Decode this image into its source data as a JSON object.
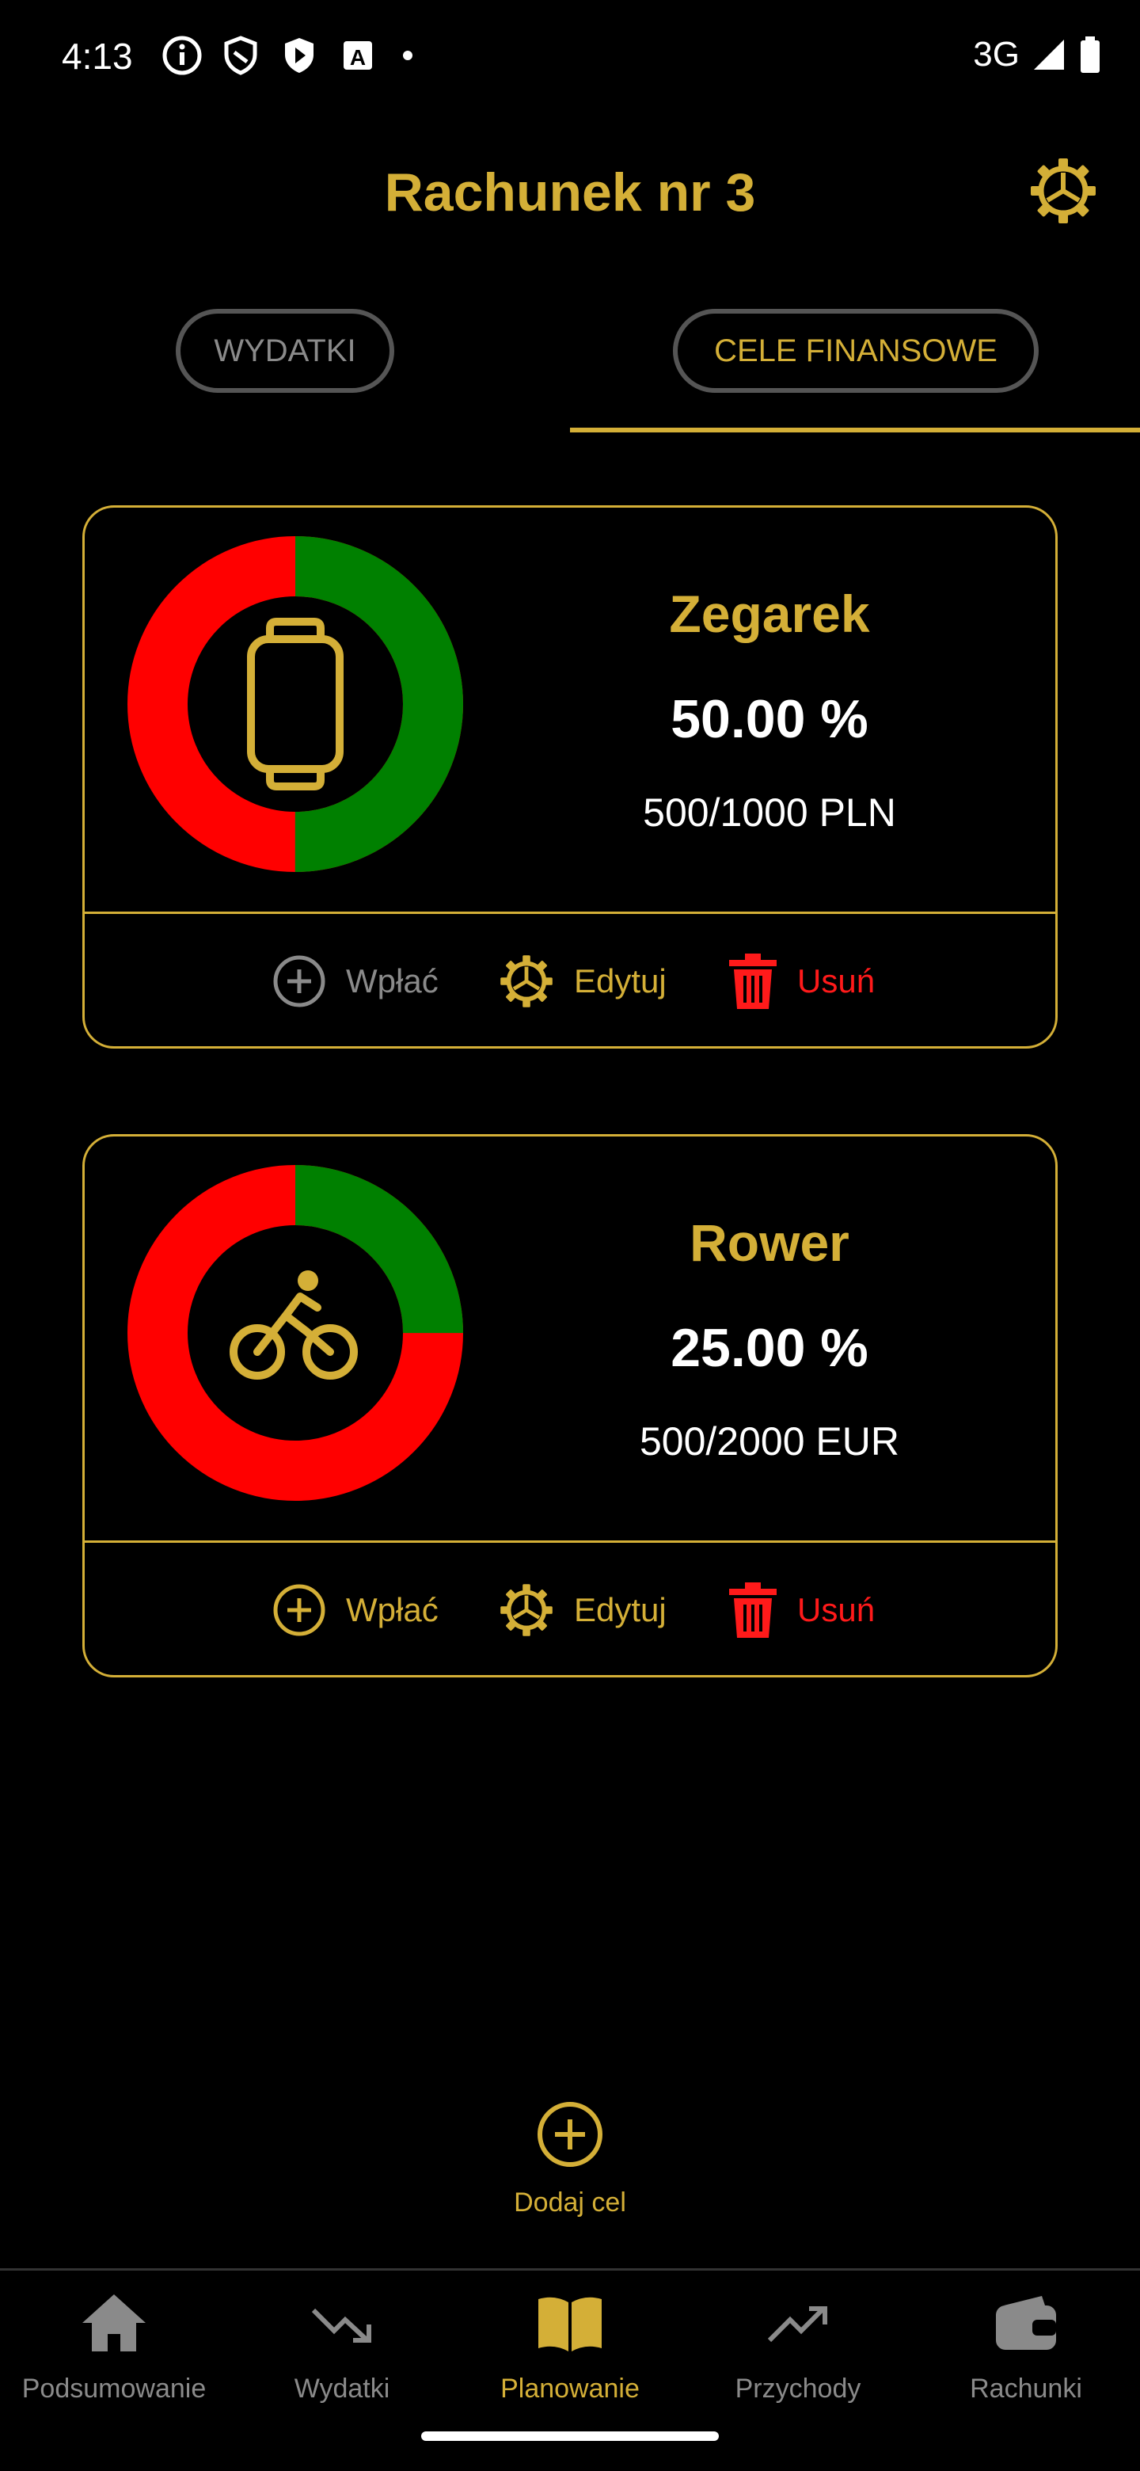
{
  "status_bar": {
    "time": "4:13",
    "network": "3G",
    "left_icons": [
      "info-icon",
      "shield-icon",
      "play-shield-icon",
      "font-a-icon",
      "dot-icon"
    ],
    "right_icons": [
      "signal-icon",
      "battery-icon"
    ]
  },
  "header": {
    "title": "Rachunek nr 3",
    "settings_icon": "gear-icon"
  },
  "tabs": [
    {
      "label": "WYDATKI",
      "selected": false
    },
    {
      "label": "CELE FINANSOWE",
      "selected": true
    }
  ],
  "goals": [
    {
      "name": "Zegarek",
      "icon": "watch-icon",
      "percent_label": "50.00 %",
      "progress_fraction": 0.5,
      "amount": "500/1000 PLN",
      "actions": {
        "deposit": "Wpłać",
        "deposit_enabled": false,
        "edit": "Edytuj",
        "delete": "Usuń"
      }
    },
    {
      "name": "Rower",
      "icon": "bicycle-icon",
      "percent_label": "25.00 %",
      "progress_fraction": 0.25,
      "amount": "500/2000 EUR",
      "actions": {
        "deposit": "Wpłać",
        "deposit_enabled": true,
        "edit": "Edytuj",
        "delete": "Usuń"
      }
    }
  ],
  "add_goal": {
    "label": "Dodaj cel",
    "icon": "plus-circle-icon"
  },
  "bottom_nav": [
    {
      "label": "Podsumowanie",
      "icon": "home-icon",
      "active": false
    },
    {
      "label": "Wydatki",
      "icon": "trending-down-icon",
      "active": false
    },
    {
      "label": "Planowanie",
      "icon": "book-icon",
      "active": true
    },
    {
      "label": "Przychody",
      "icon": "trending-up-icon",
      "active": false
    },
    {
      "label": "Rachunki",
      "icon": "wallet-icon",
      "active": false
    }
  ],
  "colors": {
    "accent": "#d4af37",
    "background": "#000000",
    "progress_done": "#008000",
    "progress_remaining": "#ff0000",
    "danger": "#ff1a1a",
    "muted": "#8a8a8a"
  }
}
